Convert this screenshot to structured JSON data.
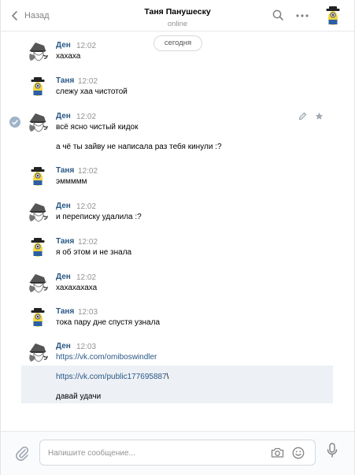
{
  "header": {
    "back_label": "Назад",
    "title": "Таня Панушеску",
    "status": "online"
  },
  "feed": {
    "date_divider": "сегодня",
    "messages": [
      {
        "author": "Ден",
        "time": "12:02",
        "lines": [
          "хахаха"
        ]
      },
      {
        "author": "Таня",
        "time": "12:02",
        "lines": [
          "слежу хаа чистотой"
        ]
      },
      {
        "author": "Ден",
        "time": "12:02",
        "lines": [
          "всё ясно чистый кидок",
          "а чё ты зайву не написала раз тебя кинули :?"
        ]
      },
      {
        "author": "Таня",
        "time": "12:02",
        "lines": [
          "эммммм"
        ]
      },
      {
        "author": "Ден",
        "time": "12:02",
        "lines": [
          "и переписку удалила :?"
        ]
      },
      {
        "author": "Таня",
        "time": "12:02",
        "lines": [
          "я об этом и не знала"
        ]
      },
      {
        "author": "Ден",
        "time": "12:02",
        "lines": [
          "хахахахаха"
        ]
      },
      {
        "author": "Таня",
        "time": "12:03",
        "lines": [
          "тока пару дне спустя узнала"
        ]
      },
      {
        "author": "Ден",
        "time": "12:03",
        "lines": [
          "https://vk.com/omiboswindler"
        ]
      }
    ],
    "followups": [
      {
        "link": "https://vk.com/public177695887",
        "suffix": "\\"
      },
      {
        "text": "давай удачи"
      }
    ]
  },
  "composer": {
    "placeholder": "Напишите сообщение..."
  },
  "icons": {
    "back": "chevron-left-icon",
    "search": "search-icon",
    "more": "more-dots-icon",
    "attach": "paperclip-icon",
    "camera": "camera-icon",
    "emoji": "smile-icon",
    "voice": "microphone-icon",
    "read": "check-icon",
    "edit": "pencil-icon",
    "important": "star-icon"
  },
  "colors": {
    "link": "#2a5885",
    "muted": "#939393",
    "highlight": "#edf0f5"
  }
}
